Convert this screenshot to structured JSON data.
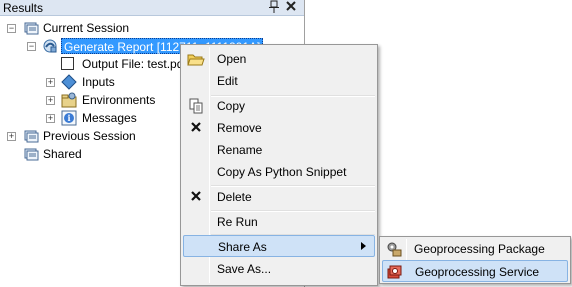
{
  "pane": {
    "title": "Results",
    "pin_glyph": "⨍",
    "close_glyph": "✕"
  },
  "tree": {
    "current_session": "Current Session",
    "generate_report": "Generate Report [112711_1111201A]",
    "output_file": "Output File: test.pdf",
    "inputs": "Inputs",
    "environments": "Environments",
    "messages": "Messages",
    "previous_session": "Previous Session",
    "shared": "Shared"
  },
  "context_menu": {
    "items": [
      {
        "label": "Open",
        "icon": "open-folder-icon"
      },
      {
        "label": "Edit",
        "icon": ""
      },
      {
        "label": "Copy",
        "icon": "copy-icon"
      },
      {
        "label": "Remove",
        "icon": "remove-x-icon"
      },
      {
        "label": "Rename",
        "icon": ""
      },
      {
        "label": "Copy As Python Snippet",
        "icon": ""
      },
      {
        "label": "Delete",
        "icon": "delete-x-icon"
      },
      {
        "label": "Re Run",
        "icon": ""
      },
      {
        "label": "Share As",
        "icon": "",
        "has_submenu": true,
        "highlighted": true
      },
      {
        "label": "Save As...",
        "icon": ""
      }
    ]
  },
  "submenu": {
    "items": [
      {
        "label": "Geoprocessing Package",
        "icon": "geoprocessing-package-icon"
      },
      {
        "label": "Geoprocessing Service",
        "icon": "geoprocessing-service-icon",
        "highlighted": true
      }
    ]
  },
  "colors": {
    "selection": "#3399ff",
    "menu_highlight": "#cfe2f7",
    "menu_highlight_border": "#87b3e3",
    "title_bar": "#dde6f2"
  }
}
